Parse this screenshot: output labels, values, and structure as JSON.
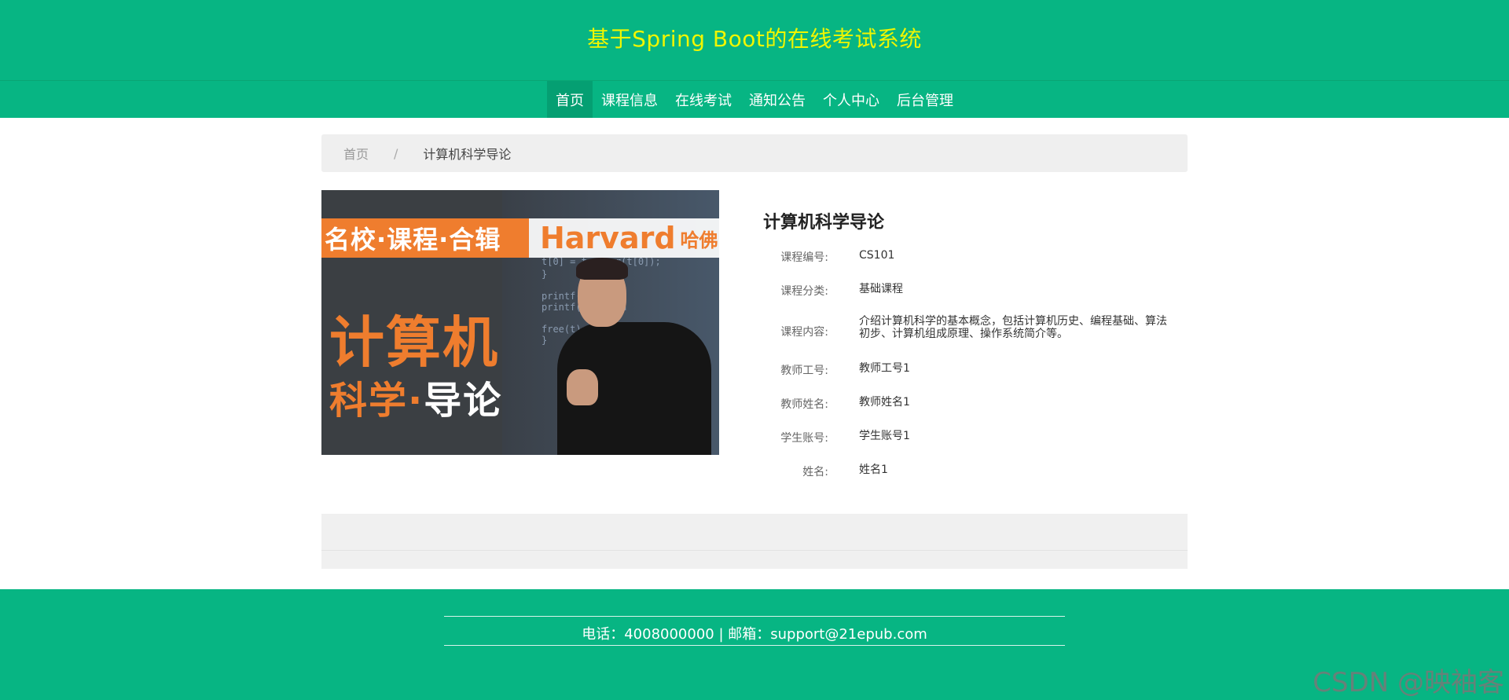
{
  "header": {
    "title": "基于Spring Boot的在线考试系统"
  },
  "nav": {
    "items": [
      {
        "label": "首页",
        "active": true
      },
      {
        "label": "课程信息"
      },
      {
        "label": "在线考试"
      },
      {
        "label": "通知公告"
      },
      {
        "label": "个人中心"
      },
      {
        "label": "后台管理"
      }
    ]
  },
  "breadcrumb": {
    "home": "首页",
    "separator": "/",
    "current": "计算机科学导论"
  },
  "course_image": {
    "banner_left": "名校·课程·合辑",
    "banner_right": "Harvard",
    "banner_right_cn": "哈佛",
    "big_line1": "计算机",
    "big_line2_a": "科学·",
    "big_line2_b": "导论",
    "code_lines": [
      "t[0] = toupper(t[0]);",
      "}",
      "printf(\"s: %s\\n",
      "printf(\"t: %s\\n",
      "free(t);",
      "}"
    ]
  },
  "course": {
    "title": "计算机科学导论",
    "fields": [
      {
        "label": "课程编号:",
        "value": "CS101"
      },
      {
        "label": "课程分类:",
        "value": "基础课程"
      },
      {
        "label": "课程内容:",
        "value": "介绍计算机科学的基本概念，包括计算机历史、编程基础、算法初步、计算机组成原理、操作系统简介等。"
      },
      {
        "label": "教师工号:",
        "value": "教师工号1"
      },
      {
        "label": "教师姓名:",
        "value": "教师姓名1"
      },
      {
        "label": "学生账号:",
        "value": "学生账号1"
      },
      {
        "label": "姓名:",
        "value": "姓名1"
      }
    ]
  },
  "footer": {
    "text": "电话：4008000000 | 邮箱：support@21epub.com"
  },
  "watermark": "CSDN @映袖客",
  "colors": {
    "brand_green": "#07b583",
    "title_yellow": "#f0f600",
    "accent_orange": "#ef7d2e"
  }
}
